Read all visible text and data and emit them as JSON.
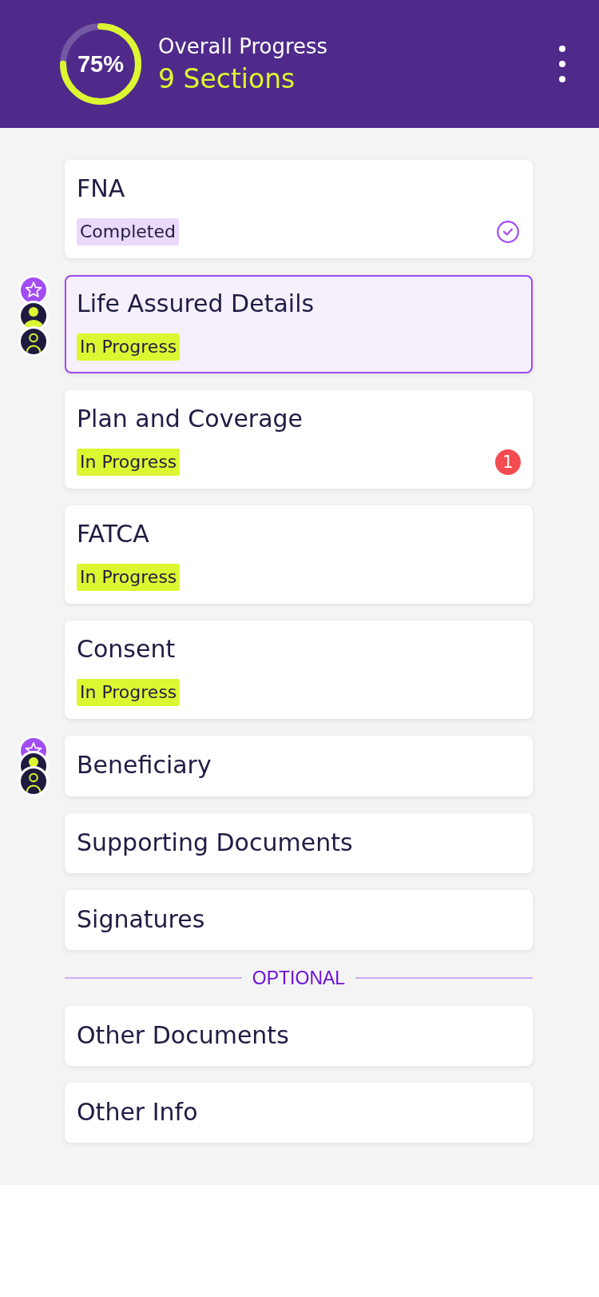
{
  "header": {
    "progress": {
      "label": "75%",
      "level": 0.75
    },
    "title": "Overall Progress",
    "subtitle": "9 Sections"
  },
  "sections": [
    {
      "title": "FNA",
      "selected": false,
      "status": {
        "label": "Completed",
        "kind": "completed"
      }
    },
    {
      "title": "Life Assured Details",
      "selected": true,
      "status": {
        "label": "In Progress",
        "kind": "in_progress"
      },
      "avatars": [
        {
          "kind": "star"
        },
        {
          "kind": "person_filled"
        },
        {
          "kind": "person_outline"
        }
      ]
    },
    {
      "title": "Plan and Coverage",
      "selected": false,
      "status": {
        "label": "In Progress",
        "kind": "in_progress"
      },
      "alert_count": "1"
    },
    {
      "title": "FATCA",
      "selected": false,
      "status": {
        "label": "In Progress",
        "kind": "in_progress"
      }
    },
    {
      "title": "Consent",
      "selected": false,
      "status": {
        "label": "In Progress",
        "kind": "in_progress"
      }
    },
    {
      "title": "Beneficiary",
      "selected": false,
      "avatars": [
        {
          "kind": "star"
        },
        {
          "kind": "person_filled"
        },
        {
          "kind": "person_outline"
        }
      ]
    },
    {
      "title": "Supporting Documents",
      "selected": false
    },
    {
      "title": "Signatures",
      "selected": false
    }
  ],
  "optional_label": "OPTIONAL",
  "optional_sections": [
    {
      "title": "Other Documents",
      "selected": false
    },
    {
      "title": "Other Info",
      "selected": false
    }
  ]
}
